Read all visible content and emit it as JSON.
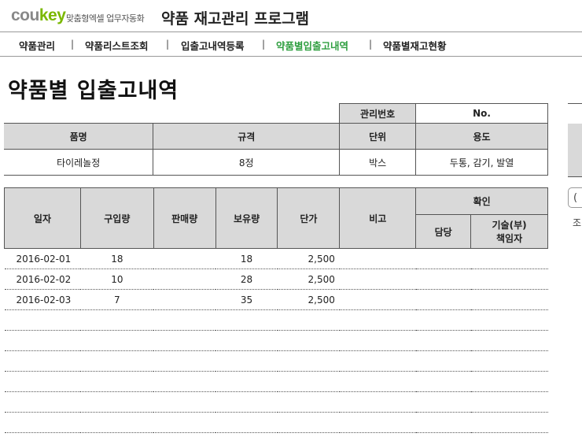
{
  "header": {
    "logo_main": "cou",
    "logo_accent": "key",
    "slogan": "맞춤형엑셀 업무자동화",
    "app_title": "약품 재고관리 프로그램"
  },
  "nav": {
    "items": [
      {
        "label": "약품관리"
      },
      {
        "label": "약품리스트조회"
      },
      {
        "label": "입출고내역등록"
      },
      {
        "label": "약품별입출고내역"
      },
      {
        "label": "약품별재고현황"
      }
    ],
    "separator": "|"
  },
  "page": {
    "title": "약품별 입출고내역"
  },
  "info": {
    "mgmt_label": "관리번호",
    "mgmt_value": "No.",
    "headers": {
      "name": "품명",
      "spec": "규격",
      "unit": "단위",
      "use": "용도"
    },
    "values": {
      "name": "타이레놀정",
      "spec": "8정",
      "unit": "박스",
      "use": "두통, 감기, 발열"
    }
  },
  "ledger": {
    "headers": {
      "date": "일자",
      "purchase": "구입량",
      "sales": "판매량",
      "stock": "보유량",
      "price": "단가",
      "note": "비고",
      "confirm": "확인",
      "manager": "담당",
      "tech_l1": "기술(부)",
      "tech_l2": "책임자"
    },
    "rows": [
      {
        "date": "2016-02-01",
        "purchase": "18",
        "sales": "",
        "stock": "18",
        "price": "2,500"
      },
      {
        "date": "2016-02-02",
        "purchase": "10",
        "sales": "",
        "stock": "28",
        "price": "2,500"
      },
      {
        "date": "2016-02-03",
        "purchase": "7",
        "sales": "",
        "stock": "35",
        "price": "2,500"
      }
    ],
    "empty_rows": 6
  },
  "side": {
    "partial_label": "조",
    "partial_glyph": "("
  }
}
